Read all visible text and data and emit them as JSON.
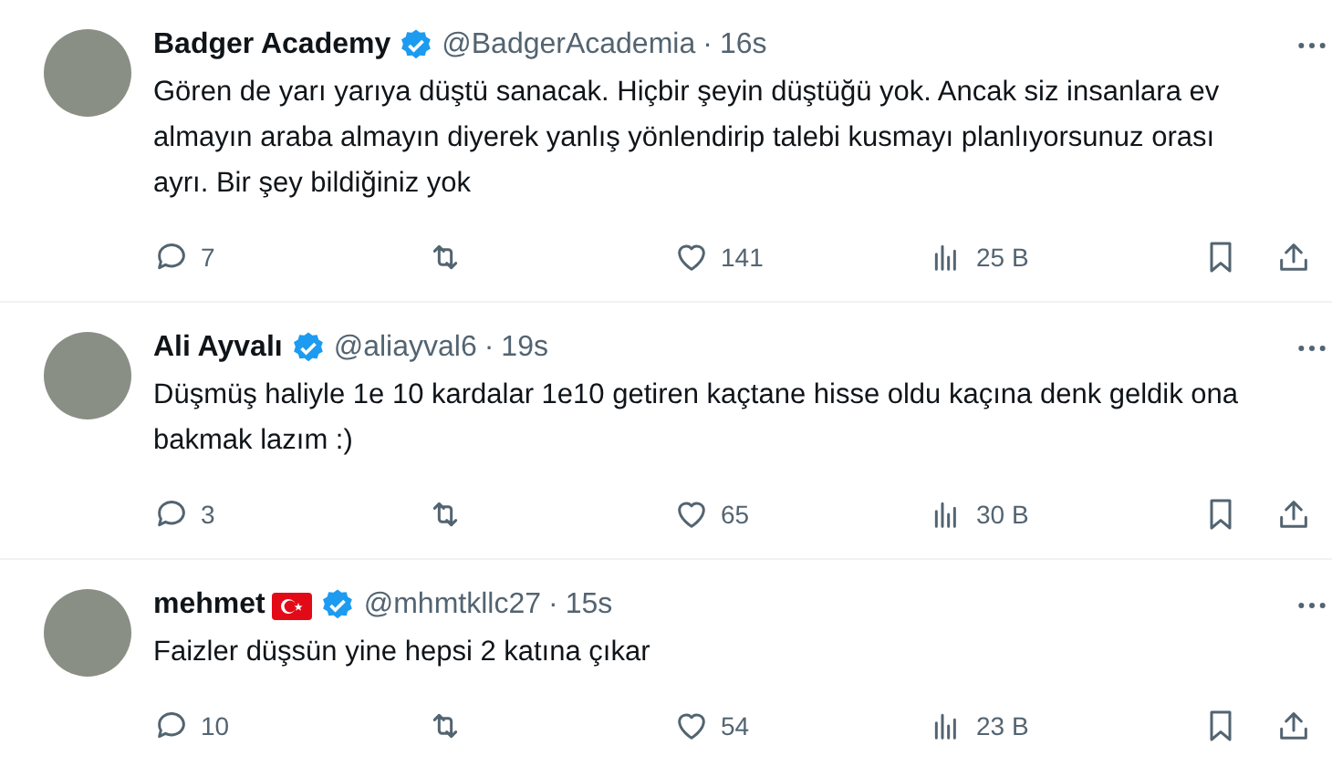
{
  "tweets": [
    {
      "name": "Badger Academy",
      "flag": false,
      "verified": true,
      "handle": "@BadgerAcademia",
      "separator": "·",
      "time": "16s",
      "text": "Gören de yarı yarıya düştü sanacak. Hiçbir şeyin düştüğü yok. Ancak siz insanlara ev almayın araba almayın diyerek yanlış yönlendirip talebi kusmayı planlıyorsunuz orası ayrı. Bir şey bildiğiniz yok",
      "replies": "7",
      "likes": "141",
      "views": "25 B"
    },
    {
      "name": "Ali Ayvalı",
      "flag": false,
      "verified": true,
      "handle": "@aliayval6",
      "separator": "·",
      "time": "19s",
      "text": "Düşmüş haliyle 1e 10 kardalar 1e10 getiren kaçtane hisse oldu kaçına denk geldik ona bakmak lazım :)",
      "replies": "3",
      "likes": "65",
      "views": "30 B"
    },
    {
      "name": "mehmet",
      "flag": true,
      "verified": true,
      "handle": "@mhmtkllc27",
      "separator": "·",
      "time": "15s",
      "text": "Faizler düşsün yine hepsi 2 katına çıkar",
      "replies": "10",
      "likes": "54",
      "views": "23 B"
    }
  ]
}
